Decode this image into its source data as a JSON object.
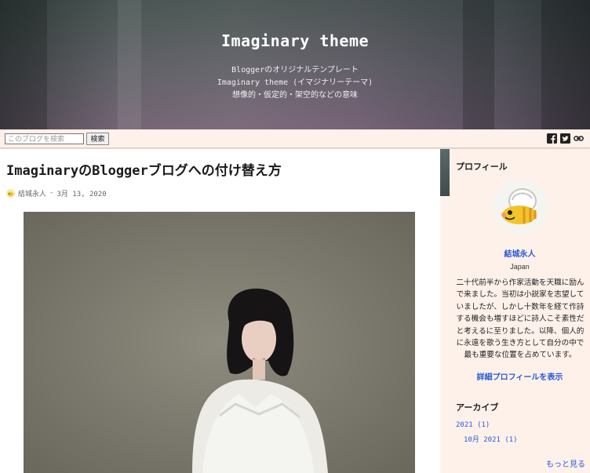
{
  "header": {
    "title": "Imaginary theme",
    "desc_line1": "Bloggerのオリジナルテンプレート",
    "desc_line2": "Imaginary theme (イマジナリーテーマ)",
    "desc_line3": "想像的・仮定的・架空的などの意味"
  },
  "toolbar": {
    "search_placeholder": "このブログを検索",
    "search_button": "検索",
    "icons": [
      "facebook-icon",
      "twitter-icon",
      "link-icon"
    ]
  },
  "post": {
    "title": "ImaginaryのBloggerブログへの付け替え方",
    "author": "結城永人",
    "separator": "-",
    "date": "3月 13, 2020"
  },
  "sidebar": {
    "profile_heading": "プロフィール",
    "name": "結城永人",
    "location": "Japan",
    "bio": "二十代前半から作家活動を天職に励んで来ました。当初は小説家を志望していましたが、しかし十数年を経て作詩する機会も増すほどに詩人こそ素性だと考えるに至りました。以降、個人的に永遠を歌う生き方として自分の中で最も重要な位置を占めています。",
    "profile_link": "詳細プロフィールを表示",
    "archive_heading": "アーカイブ",
    "archive_year": "2021 (1)",
    "archive_month": "10月 2021 (1)",
    "more_link": "もっと見る"
  },
  "colors": {
    "link": "#2a5bd7",
    "background": "#fdf1ea"
  }
}
